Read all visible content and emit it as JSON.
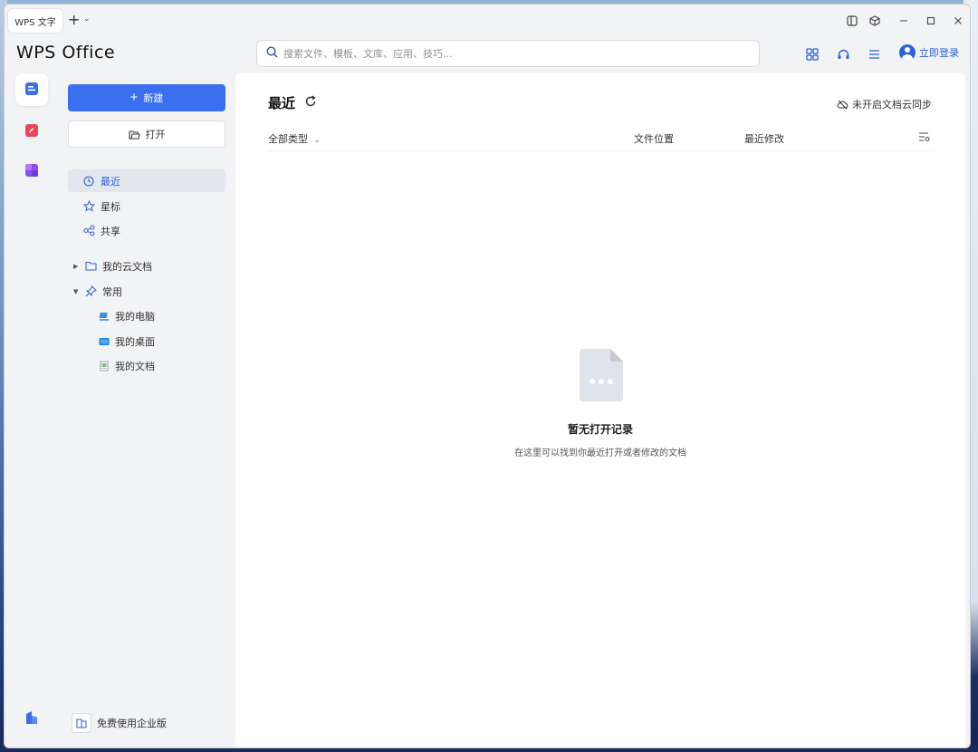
{
  "titlebar": {
    "doc_tab_label": "WPS 文字",
    "add_tab_glyph": "+",
    "tab_dropdown_glyph": "⌄"
  },
  "header": {
    "logo": "WPS Office",
    "search_placeholder": "搜索文件、模板、文库、应用、技巧...",
    "login_label": "立即登录"
  },
  "sidebar": {
    "new_label": "新建",
    "open_label": "打开",
    "nav": [
      {
        "label": "最近",
        "icon": "clock-icon",
        "active": true
      },
      {
        "label": "星标",
        "icon": "star-icon",
        "active": false
      },
      {
        "label": "共享",
        "icon": "share-icon",
        "active": false
      }
    ],
    "tree": [
      {
        "label": "我的云文档",
        "icon": "folder-icon",
        "expanded": false
      },
      {
        "label": "常用",
        "icon": "pin-icon",
        "expanded": true
      }
    ],
    "common_items": [
      {
        "label": "我的电脑",
        "icon": "computer-icon"
      },
      {
        "label": "我的桌面",
        "icon": "desktop-icon"
      },
      {
        "label": "我的文档",
        "icon": "document-icon"
      }
    ],
    "enterprise_label": "免费使用企业版"
  },
  "main": {
    "title": "最近",
    "sync_label": "未开启文档云同步",
    "filter_label": "全部类型",
    "columns": [
      "文件位置",
      "最近修改"
    ],
    "empty_title": "暂无打开记录",
    "empty_desc": "在这里可以找到你最近打开或者修改的文档"
  },
  "colors": {
    "accent": "#3a6ff0",
    "active_text": "#2a5fd4",
    "sidebar_bg": "#f2f3f5",
    "active_nav_bg": "#e2e6ee"
  }
}
